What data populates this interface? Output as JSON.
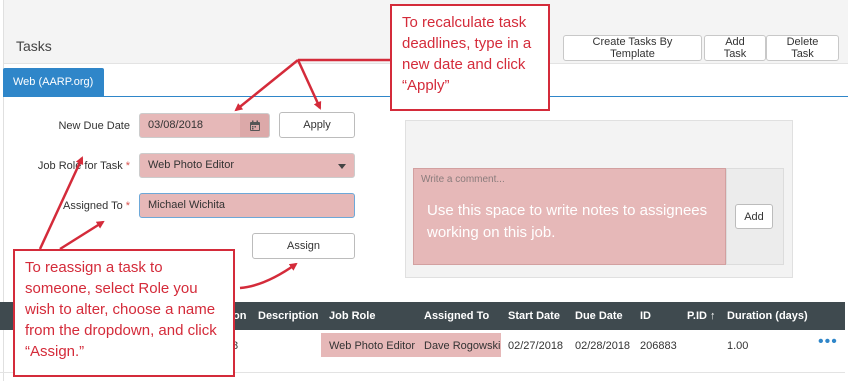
{
  "panel": {
    "title": "Tasks"
  },
  "header_buttons": {
    "create_from_template": "Create Tasks By Template",
    "add_task": "Add Task",
    "delete_task": "Delete Task"
  },
  "tab": {
    "label": "Web (AARP.org)"
  },
  "form": {
    "new_due_date_label": "New Due Date",
    "new_due_date_value": "03/08/2018",
    "apply_label": "Apply",
    "job_role_label": "Job Role for Task",
    "job_role_required": "*",
    "job_role_value": "Web Photo Editor",
    "assigned_to_label": "Assigned To",
    "assigned_to_required": "*",
    "assigned_to_value": "Michael Wichita",
    "assign_label": "Assign"
  },
  "comment": {
    "placeholder": "Write a comment...",
    "add_label": "Add",
    "note": "Use this space to write notes to assignees working on this job."
  },
  "table": {
    "columns": [
      "on",
      "Description",
      "Job Role",
      "Assigned To",
      "Start Date",
      "Due Date",
      "ID",
      "P.ID ↑",
      "Duration (days)"
    ],
    "row": {
      "partial": "8",
      "job_role": "Web Photo Editor",
      "assigned_to": "Dave Rogowski",
      "start_date": "02/27/2018",
      "due_date": "02/28/2018",
      "id": "206883",
      "duration": "1.00",
      "more": "•••"
    }
  },
  "callouts": {
    "recalculate": "To recalculate task deadlines, type in a new date and click “Apply”",
    "reassign": "To reassign a task to someone, select Role you wish to alter, choose a name from the dropdown, and click “Assign.”"
  },
  "colors": {
    "accent_blue": "#2f86c9",
    "annotation_red": "#d42b3a",
    "highlight_pink": "#e6b8b8",
    "table_header": "#3f4a4f"
  },
  "icons": {
    "calendar": "calendar-icon",
    "dropdown": "chevron-down-icon",
    "more": "more-dots-icon"
  }
}
